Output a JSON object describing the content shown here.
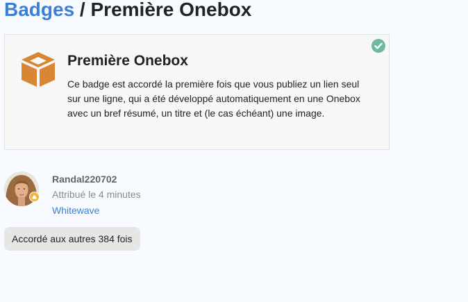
{
  "breadcrumb": {
    "parent_label": "Badges",
    "separator": " / ",
    "current_label": "Première Onebox"
  },
  "badge": {
    "name": "Première Onebox",
    "description": "Ce badge est accordé la première fois que vous publiez un lien seul sur une ligne, qui a été développé automatiquement en une Onebox avec un bref résumé, un titre et (le cas échéant) une image.",
    "icon": "cube-icon",
    "icon_color": "#d88633",
    "granted": true,
    "granted_icon": "check-circle-icon",
    "granted_color": "#6fb99b"
  },
  "grant": {
    "username": "Randal220702",
    "time_text": "Attribué le 4 minutes",
    "topic_link": "Whitewave",
    "avatar": "user-avatar",
    "flair_icon": "flair-badge-icon"
  },
  "others": {
    "label": "Accordé aux autres 384 fois"
  },
  "theme": {
    "link_color": "#3b7fd6",
    "background": "#f7fafe"
  }
}
